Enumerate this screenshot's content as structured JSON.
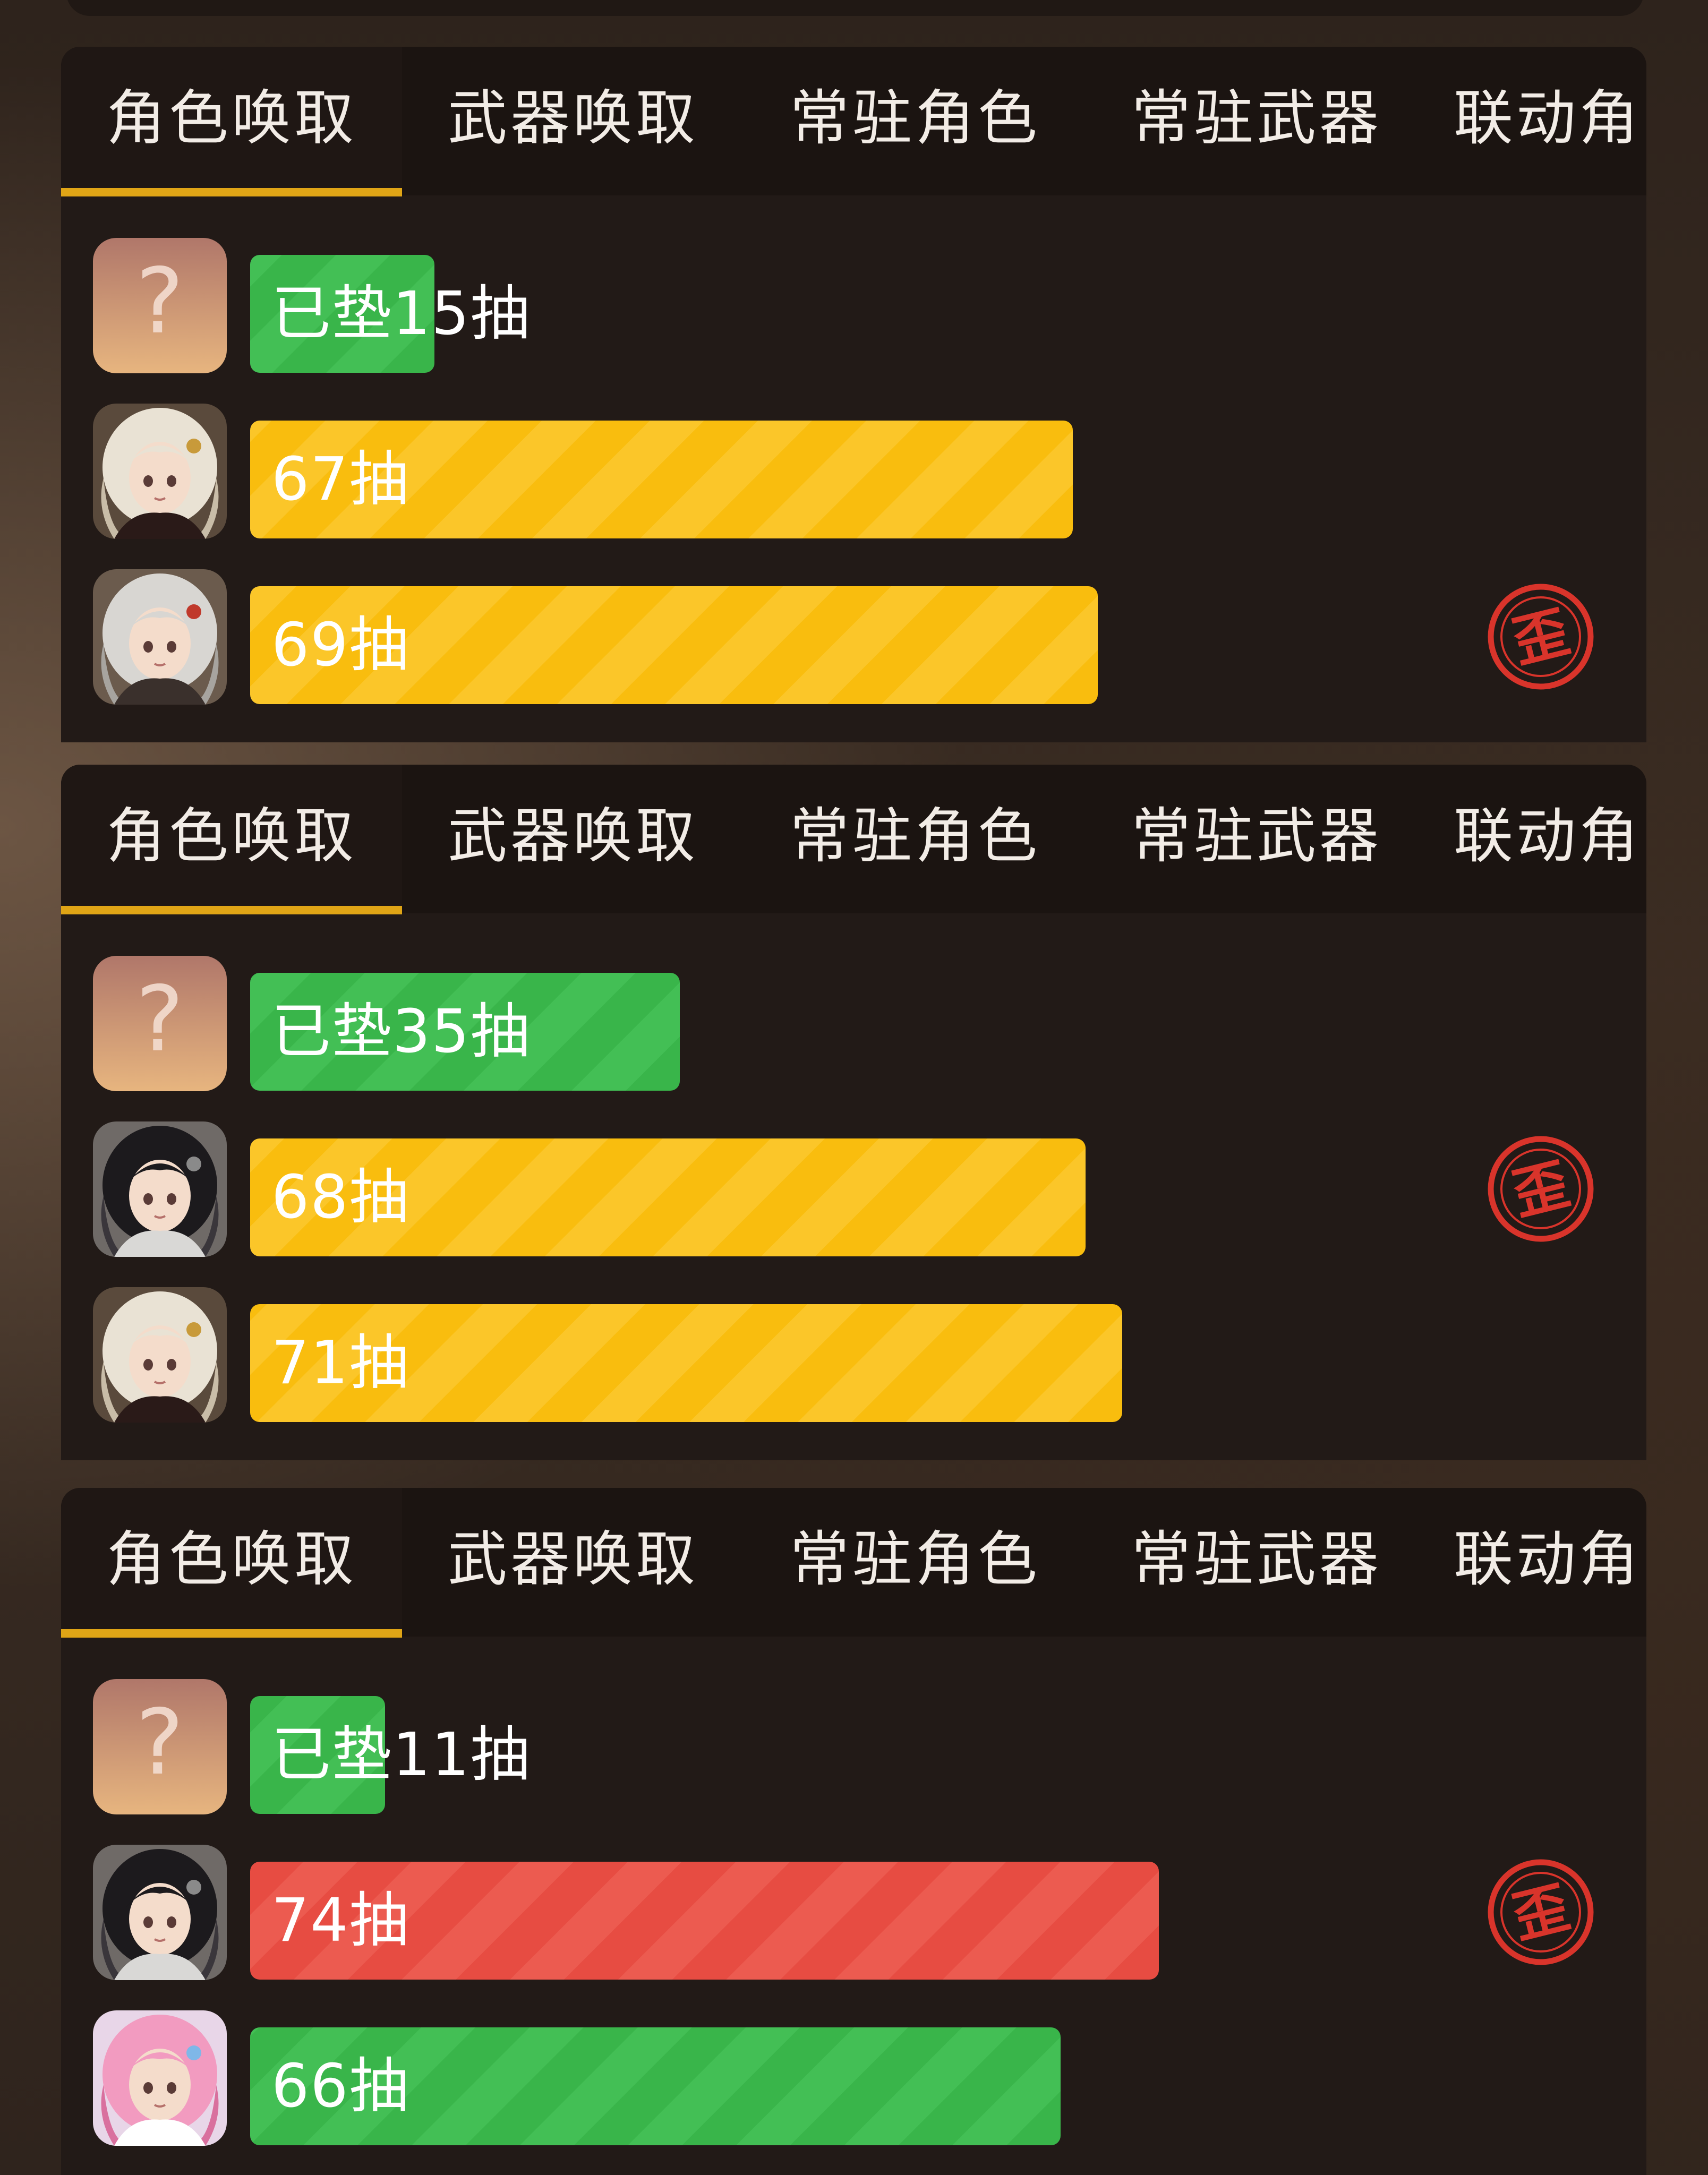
{
  "tabs": [
    "角色唤取",
    "武器唤取",
    "常驻角色",
    "常驻武器",
    "联动角"
  ],
  "colors": {
    "accent": "#e0a516",
    "green": "#39b54a",
    "yellow": "#f9bd0e",
    "red": "#e74c42",
    "stamp": "#d9342b",
    "panel": "#221a17"
  },
  "stamp_glyph": "歪",
  "panels": [
    {
      "rows": [
        {
          "avatar": "unknown-avatar",
          "label": "已垫15抽",
          "bar_color": "green",
          "pulls": 15,
          "stamp": false
        },
        {
          "avatar": "white-haired-girl-avatar",
          "label": "67抽",
          "bar_color": "yellow",
          "pulls": 67,
          "stamp": false
        },
        {
          "avatar": "grey-haired-girl-avatar",
          "label": "69抽",
          "bar_color": "yellow",
          "pulls": 69,
          "stamp": true
        }
      ]
    },
    {
      "rows": [
        {
          "avatar": "unknown-avatar",
          "label": "已垫35抽",
          "bar_color": "green",
          "pulls": 35,
          "stamp": false
        },
        {
          "avatar": "black-haired-boy-avatar",
          "label": "68抽",
          "bar_color": "yellow",
          "pulls": 68,
          "stamp": true
        },
        {
          "avatar": "white-haired-girl-avatar",
          "label": "71抽",
          "bar_color": "yellow",
          "pulls": 71,
          "stamp": false
        }
      ]
    },
    {
      "rows": [
        {
          "avatar": "unknown-avatar",
          "label": "已垫11抽",
          "bar_color": "green",
          "pulls": 11,
          "stamp": false
        },
        {
          "avatar": "black-haired-boy-avatar",
          "label": "74抽",
          "bar_color": "red",
          "pulls": 74,
          "stamp": true
        },
        {
          "avatar": "pink-haired-girl-avatar",
          "label": "66抽",
          "bar_color": "green",
          "pulls": 66,
          "stamp": false
        }
      ]
    }
  ]
}
